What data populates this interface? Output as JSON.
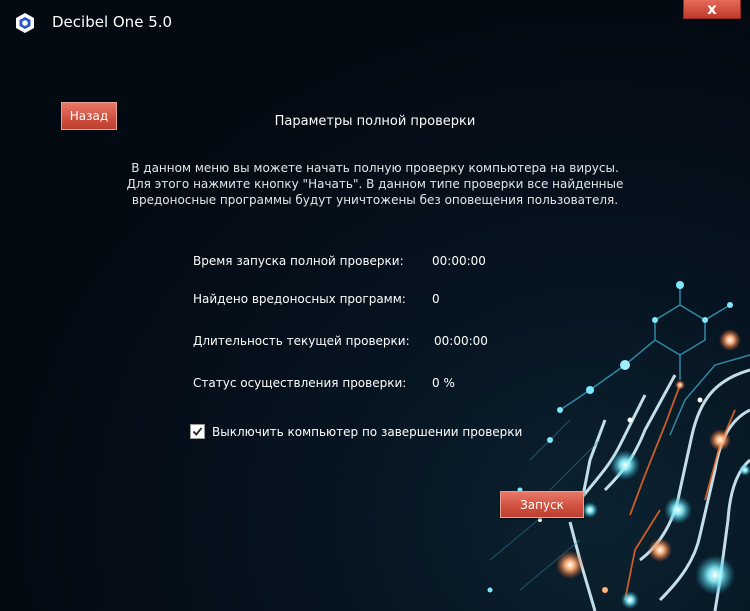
{
  "window": {
    "title": "Decibel One 5.0",
    "close_symbol": "x",
    "accent_color": "#cf4f3e"
  },
  "nav": {
    "back_label": "Назад"
  },
  "page": {
    "title": "Параметры полной проверки",
    "description_lines": [
      "В данном меню вы можете начать полную проверку компьютера на вирусы.",
      "Для этого нажмите кнопку \"Начать\". В данном типе проверки все найденные",
      "вредоносные программы будут уничтожены без оповещения пользователя."
    ]
  },
  "stats": {
    "start_time_label": "Время запуска полной проверки:",
    "start_time_value": "00:00:00",
    "malware_found_label": "Найдено вредоносных программ:",
    "malware_found_value": "0",
    "duration_label": "Длительность текущей проверки:",
    "duration_value": "00:00:00",
    "status_label": "Статус осуществления  проверки:",
    "status_value": "0 %"
  },
  "options": {
    "shutdown_label": "Выключить компьютер по завершении проверки",
    "shutdown_checked": true
  },
  "actions": {
    "start_label": "Запуск"
  },
  "icons": {
    "logo": "decibel-logo-icon",
    "close": "close-icon",
    "check": "checkmark-icon"
  }
}
